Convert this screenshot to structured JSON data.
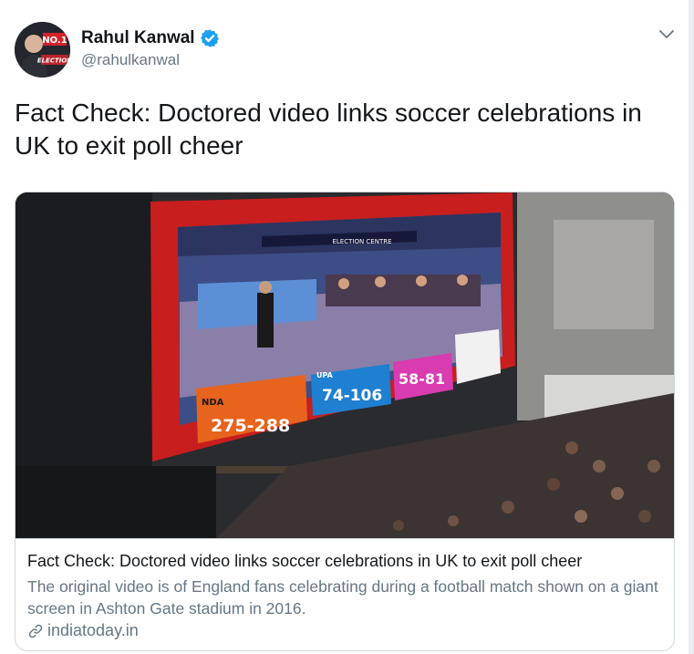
{
  "author": {
    "name": "Rahul Kanwal",
    "handle": "@rahulkanwal",
    "avatar_badge": "NO.1",
    "avatar_caption": "ELECTION"
  },
  "tweet": {
    "text": "Fact Check: Doctored video links soccer celebrations in UK to exit poll cheer"
  },
  "card": {
    "title": "Fact Check: Doctored video links soccer celebrations in UK to exit poll cheer",
    "description": "The original video is of England fans celebrating during a football match shown on a giant screen in Ashton Gate stadium in 2016.",
    "domain": "indiatoday.in",
    "screen": {
      "banner": "ELECTION CENTRE",
      "nda_label": "NDA",
      "nda_score": "275-288",
      "upa_label": "UPA",
      "upa_score": "74-106",
      "others_score": "58-81"
    }
  },
  "icons": {
    "verified": "verified-badge-icon",
    "caret": "chevron-down-icon",
    "link": "link-icon"
  },
  "colors": {
    "verified_blue": "#1da1f2",
    "nda_orange": "#e8631c",
    "upa_blue": "#1f7fd1",
    "others_pink": "#d93bb0",
    "screen_red": "#c81e1e"
  }
}
